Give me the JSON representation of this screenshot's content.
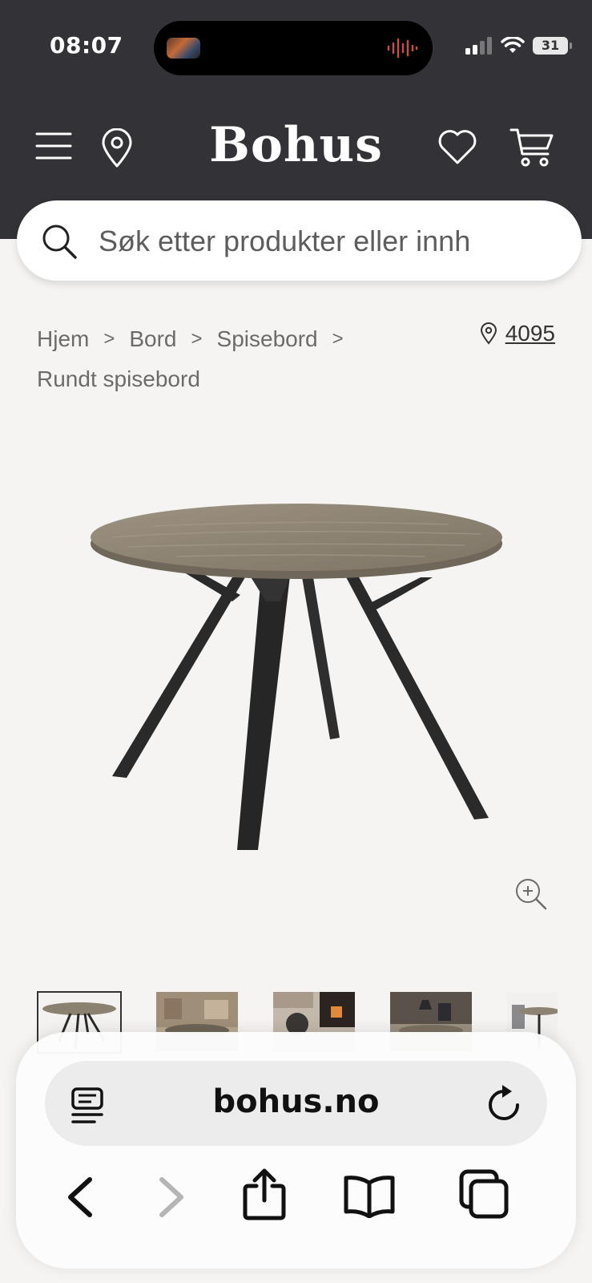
{
  "status_bar": {
    "time": "08:07",
    "battery": "31"
  },
  "header": {
    "logo": "Bohus",
    "icons": [
      "menu-icon",
      "location-pin-icon",
      "heart-icon",
      "cart-icon"
    ]
  },
  "search": {
    "placeholder": "Søk etter produkter eller innh"
  },
  "breadcrumb": {
    "items": [
      "Hjem",
      "Bord",
      "Spisebord",
      "Rundt spisebord"
    ],
    "separator": ">"
  },
  "store": {
    "postal_code": "4095"
  },
  "gallery": {
    "thumbnail_count": 5,
    "active_index": 0
  },
  "browser": {
    "url": "bohus.no",
    "toolbar": [
      "back-icon",
      "forward-icon",
      "share-icon",
      "bookmarks-icon",
      "tabs-icon"
    ]
  },
  "colors": {
    "header_bg": "#333237",
    "page_bg": "#f5f4f2",
    "text_muted": "#6d6b69"
  }
}
